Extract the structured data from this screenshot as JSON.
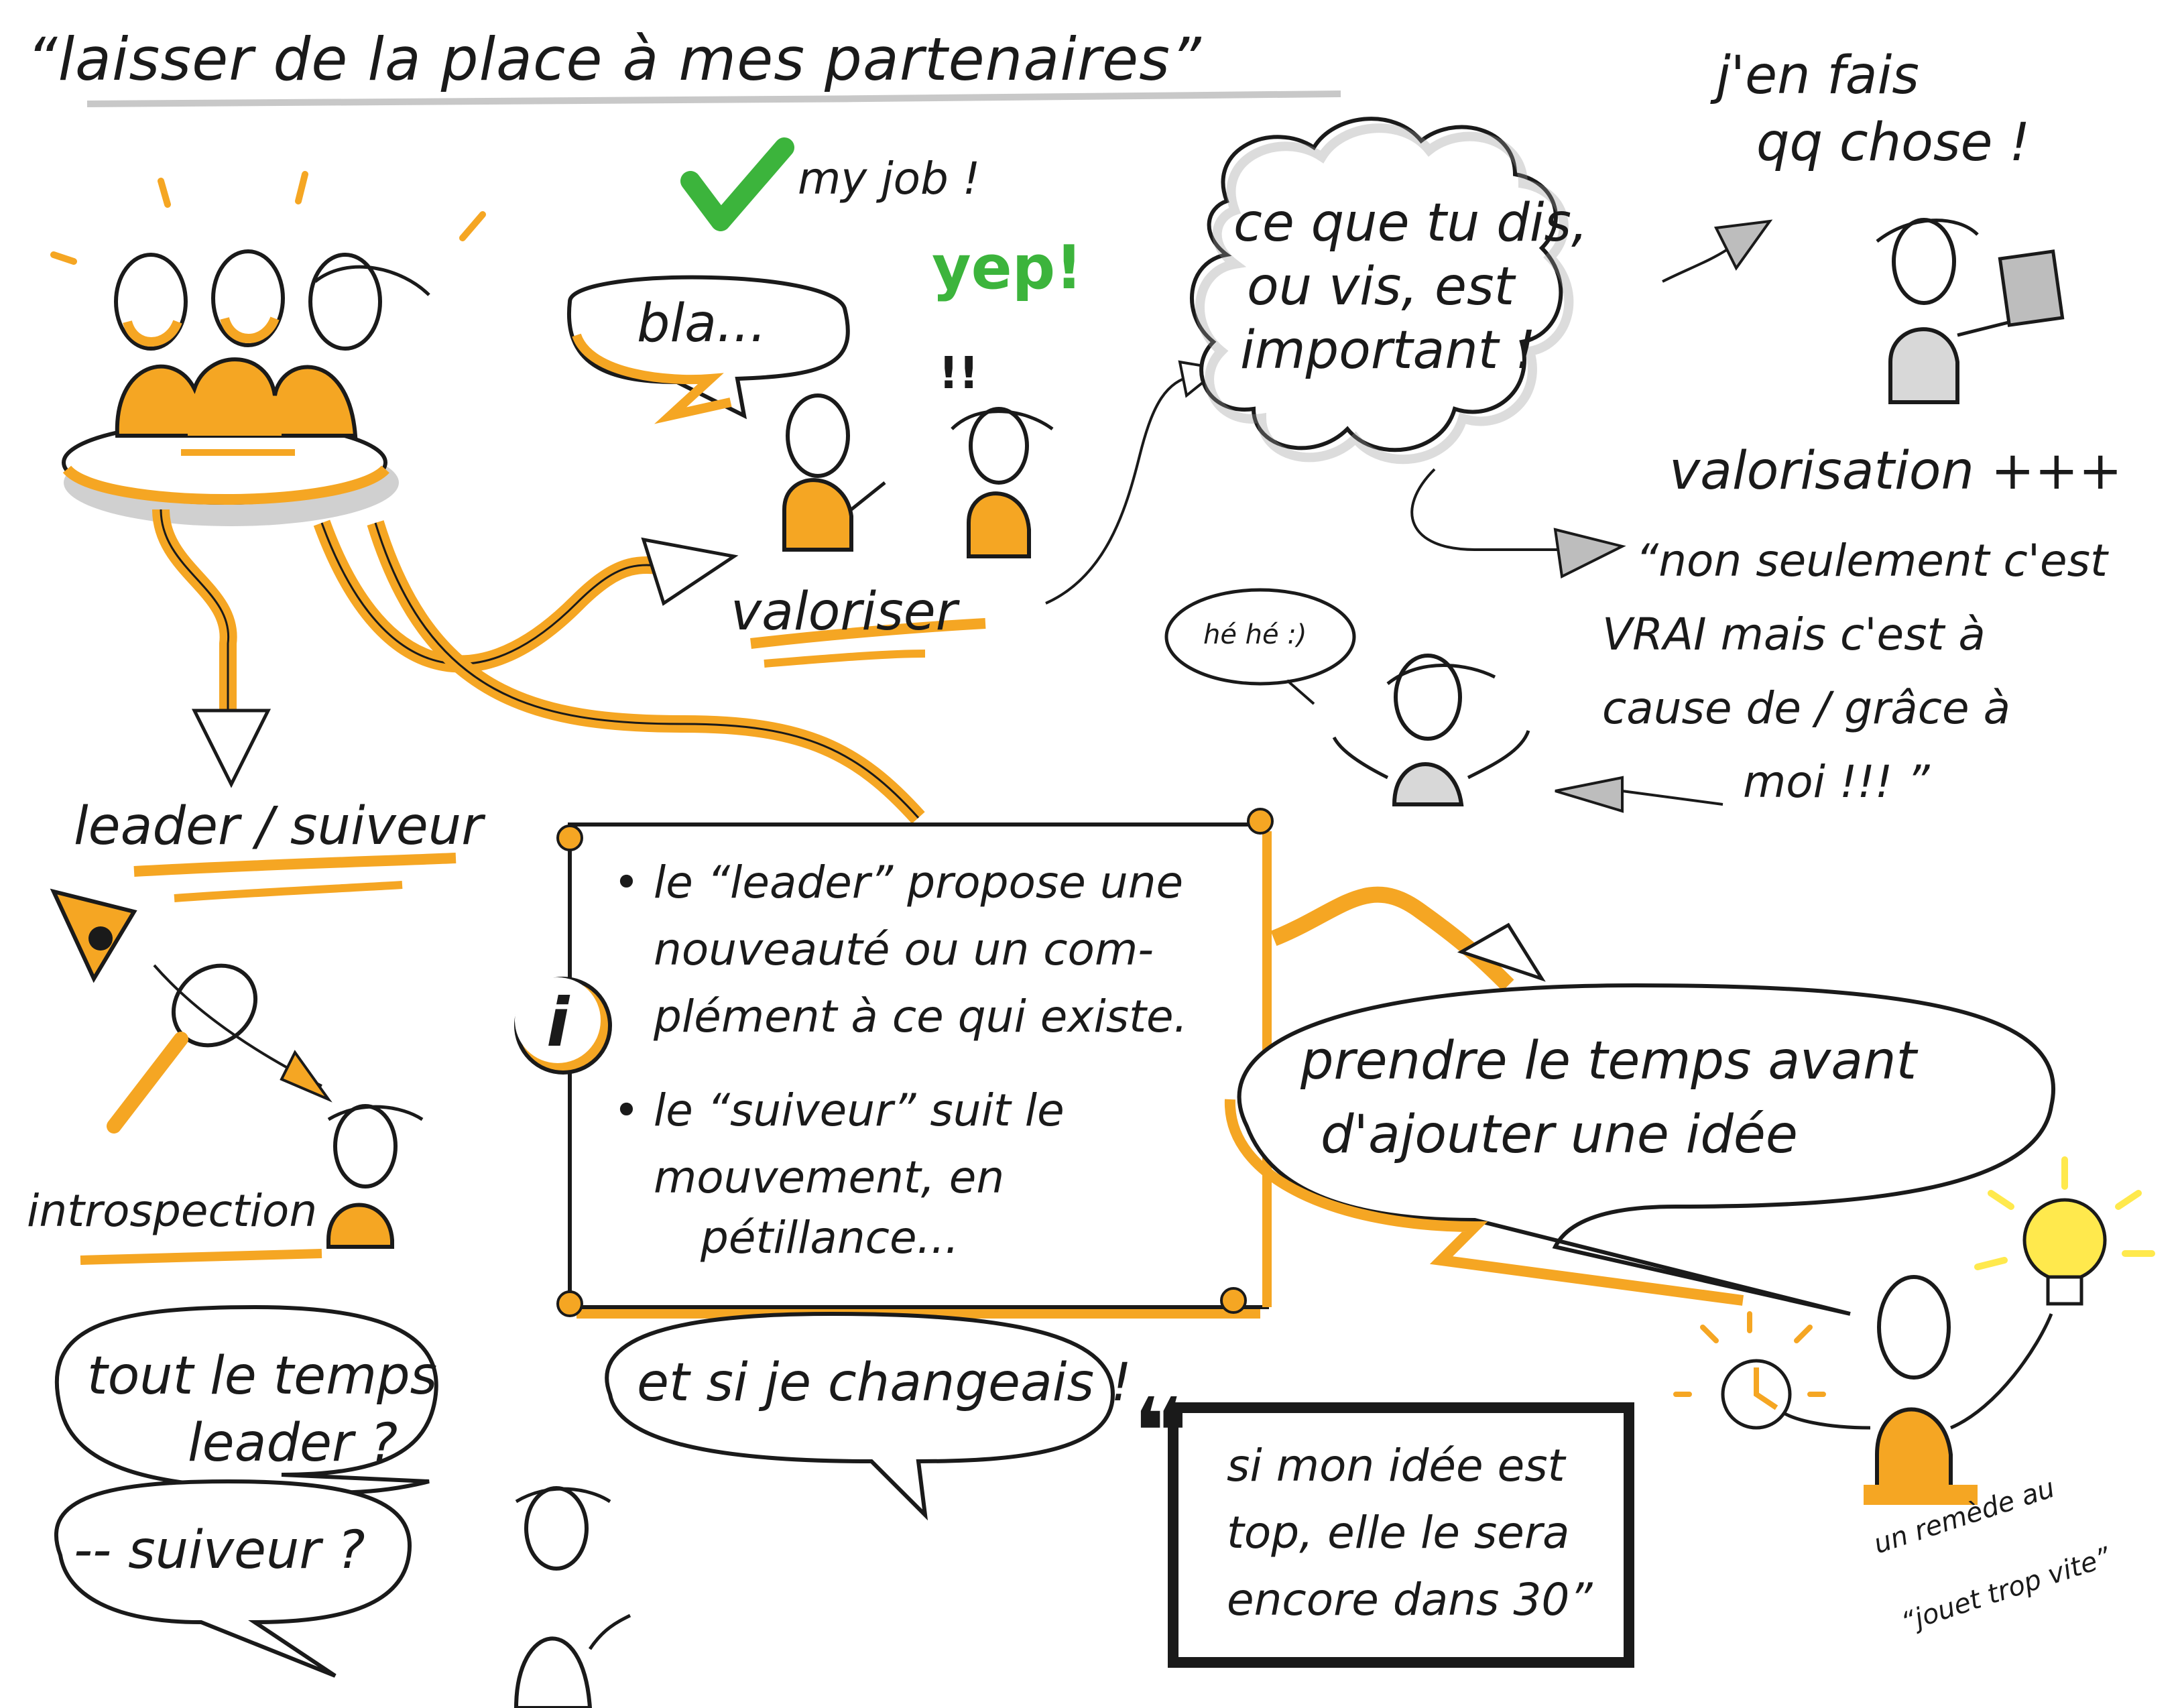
{
  "colors": {
    "ink": "#1a1a1a",
    "orange": "#f5a623",
    "grey_shadow": "#9a9a9a",
    "green": "#3cb43c",
    "yellow": "#ffe94d"
  },
  "title": "“laisser de la place à mes partenaires”",
  "team": {
    "check_icon": "check-icon",
    "my_job": "my job !",
    "yep": "yep!",
    "exclaim": "!!",
    "bla": "bla...",
    "valoriser": "valoriser"
  },
  "cloud": {
    "lines": [
      "ce que tu dis,",
      "ou vis, est",
      "important !"
    ]
  },
  "top_right": {
    "lines": [
      "j'en fais",
      "qq chose !"
    ]
  },
  "valorisation": {
    "heading": "valorisation +++",
    "quote_lines": [
      "“non seulement c'est",
      "VRAI mais c'est à",
      "cause de / grâce à",
      "moi !!! ”"
    ],
    "hehe": "hé hé :)"
  },
  "left": {
    "leader_suiveur": "leader / suiveur",
    "introspection": "introspection"
  },
  "info_box": {
    "icon": "info-icon",
    "bullet1_lines": [
      "• le “leader” propose une",
      "nouveauté ou un com-",
      "plément à ce qui existe."
    ],
    "bullet2_lines": [
      "• le “suiveur” suit le",
      "mouvement, en",
      "pétillance..."
    ]
  },
  "prendre": {
    "lines": [
      "prendre le temps avant",
      "d'ajouter une idée"
    ]
  },
  "remede": {
    "lines": [
      "un remède au",
      "“jouet trop vite”"
    ]
  },
  "bottom_left": {
    "bubble1_lines": [
      "tout le temps",
      "leader ?"
    ],
    "bubble2": "-- suiveur ?",
    "bubble3": "et si je changeais !"
  },
  "quote_box": {
    "marks": "❝",
    "lines": [
      "si mon idée est",
      "top, elle le sera",
      "encore dans 30”"
    ]
  }
}
